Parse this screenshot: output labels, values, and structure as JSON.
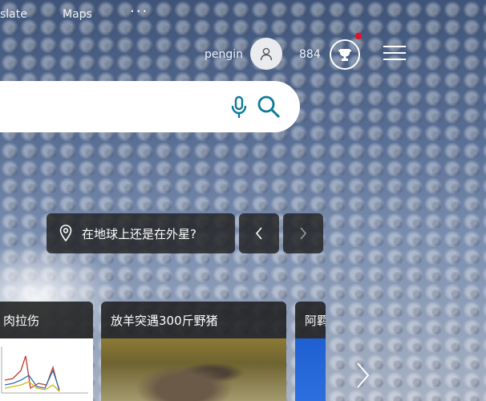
{
  "topnav": {
    "items": [
      {
        "label": "slate"
      },
      {
        "label": "Maps"
      }
    ],
    "more_label": "···"
  },
  "user": {
    "name": "pengin",
    "points": "884"
  },
  "search": {
    "value": "",
    "placeholder": ""
  },
  "hero": {
    "location_text": "在地球上还是在外星?"
  },
  "news": [
    {
      "title": "肉拉伤"
    },
    {
      "title": "放羊突遇300斤野猪"
    },
    {
      "title": "阿羁"
    }
  ],
  "colors": {
    "accent": "#0e7a99",
    "notification": "#e81123",
    "card_bg": "#1e1e1e"
  }
}
